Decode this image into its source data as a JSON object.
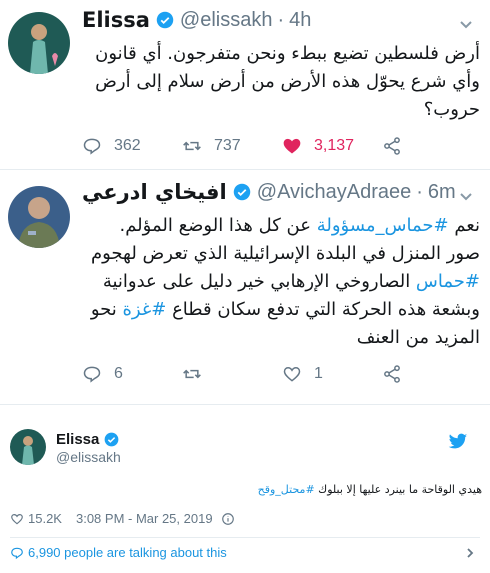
{
  "tweet1": {
    "name": "Elissa",
    "handle": "@elissakh",
    "time": "4h",
    "text_lines": [
      "أرض فلسطين تضيع ببطء ونحن متفرجون. أي قانون",
      "وأي شرع يحوّل هذه الأرض من أرض سلام إلى أرض",
      "حروب؟"
    ],
    "reply_count": "362",
    "retweet_count": "737",
    "like_count": "3,137",
    "like_color": "#e0245e"
  },
  "tweet2": {
    "name": "افيخاي ادرعي",
    "handle": "@AvichayAdraee",
    "time": "6m",
    "line1_pre": "نعم ",
    "line1_tag": "#حماس_مسؤولة",
    "line1_post": " عن كل هذا الوضع المؤلم.",
    "line2": "صور المنزل في البلدة الإسرائيلية الذي تعرض لهجوم",
    "line3_tag": "#حماس",
    "line3_post": " الصاروخي الإرهابي خير دليل على عدوانية",
    "line4_pre": "وبشعة هذه الحركة التي تدفع سكان قطاع ",
    "line4_tag": "#غزة",
    "line4_post": " نحو",
    "line5": "المزيد من العنف",
    "reply_count": "6",
    "retweet_count": "",
    "like_count": "1"
  },
  "embed": {
    "name": "Elissa",
    "handle": "@elissakh",
    "text_pre": "هيدي الوقاحة ما بينرد عليها إلا ببلوك ",
    "text_tag": "#محتل_وقح",
    "likes": "15.2K",
    "timestamp": "3:08 PM - Mar 25, 2019",
    "talking": "6,990 people are talking about this"
  },
  "colors": {
    "link": "#1b95e0",
    "verified": "#1da1f2",
    "secondary_text": "#657786"
  }
}
